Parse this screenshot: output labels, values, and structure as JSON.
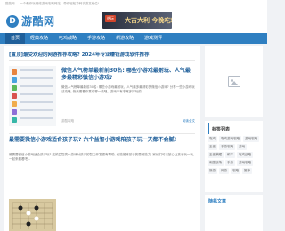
{
  "topbar": {
    "text": "猫能网 — 一个教你玩网络游戏攻略网站、带你轻松冲刺手游高段位!"
  },
  "header": {
    "logo_badge": "D",
    "logo_text": "游酷网",
    "banner_tag": "热玩",
    "banner_text": "大吉大利 今晚吃鸡"
  },
  "nav": {
    "items": [
      {
        "label": "首页"
      },
      {
        "label": "经典攻略"
      },
      {
        "label": "吃鸡战略"
      },
      {
        "label": "手游攻略"
      },
      {
        "label": "新游攻略"
      },
      {
        "label": "游戏测评"
      }
    ]
  },
  "main": {
    "title": "[置顶]最受欢迎的网游推荐攻略? 2024年专业赚钱游戏软件推荐",
    "articles": [
      {
        "title": "微信人气榜单最新前30名: 哪些小游戏最耐玩、人气最多最精彩微信小游戏?",
        "desc": "微信人气榜单最新前30名: 哪些小游戏最耐玩、人气最多最精彩的微信小游戏? 分享一些小游戏玩法攻略, 快来看看你喜欢哪一款吧。游戏中有非常多好玩的...",
        "meta": "游酷攻略",
        "more": "阅读全文"
      },
      {
        "title": "最需要微信小游戏适合孩子玩? 六个益智小游戏陪孩子玩一天都不会腻!",
        "desc": "最需要微信小游戏适合孩子玩? 这款益智类小游戏对孩子的智力开发很有帮助, 也能锻炼孩子的思维能力, 家长们可以放心让孩子玩一玩, 一起来看看吧...",
        "meta": "游酷攻略",
        "more": "阅读全文"
      }
    ]
  },
  "sidebar": {
    "tags_title": "标签列表",
    "tags": [
      "吃鸡",
      "吃鸡游戏攻略",
      "游戏攻略",
      "王者",
      "手游攻略",
      "游戏",
      "王者荣耀",
      "和平",
      "吃鸡战略",
      "刺激战场",
      "手游",
      "游戏攻略",
      "新游",
      "网游",
      "攻略",
      "推荐"
    ],
    "box2_title": "随机文章"
  },
  "colors": {
    "brand": "#2f7fc1",
    "nav": "#2f7fc1"
  }
}
